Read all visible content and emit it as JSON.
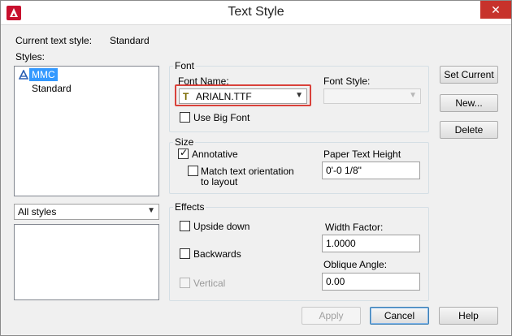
{
  "window": {
    "title": "Text Style",
    "close_glyph": "✕"
  },
  "current": {
    "label": "Current text style:",
    "value": "Standard"
  },
  "styles": {
    "label": "Styles:",
    "items": [
      {
        "label": "MMC",
        "selected": true,
        "annotative": true
      },
      {
        "label": "Standard",
        "selected": false,
        "annotative": false
      }
    ],
    "filter_value": "All styles"
  },
  "font": {
    "group_title": "Font",
    "font_name_label": "Font Name:",
    "font_name_value": "ARIALN.TTF",
    "font_style_label": "Font Style:",
    "font_style_value": "",
    "use_big_font_label": "Use Big Font",
    "use_big_font_checked": false
  },
  "size": {
    "group_title": "Size",
    "annotative_label": "Annotative",
    "annotative_checked": true,
    "match_label_line1": "Match text orientation",
    "match_label_line2": "to layout",
    "match_checked": false,
    "paper_height_label": "Paper Text Height",
    "paper_height_value": "0'-0 1/8\""
  },
  "effects": {
    "group_title": "Effects",
    "upside_down_label": "Upside down",
    "upside_down_checked": false,
    "backwards_label": "Backwards",
    "backwards_checked": false,
    "vertical_label": "Vertical",
    "vertical_checked": false,
    "width_factor_label": "Width Factor:",
    "width_factor_value": "1.0000",
    "oblique_label": "Oblique Angle:",
    "oblique_value": "0.00"
  },
  "buttons": {
    "set_current": "Set Current",
    "new": "New...",
    "delete": "Delete",
    "apply": "Apply",
    "cancel": "Cancel",
    "help": "Help"
  },
  "colors": {
    "selection": "#3399ff",
    "close_button": "#c7322b",
    "highlight_box": "#d9413a"
  }
}
